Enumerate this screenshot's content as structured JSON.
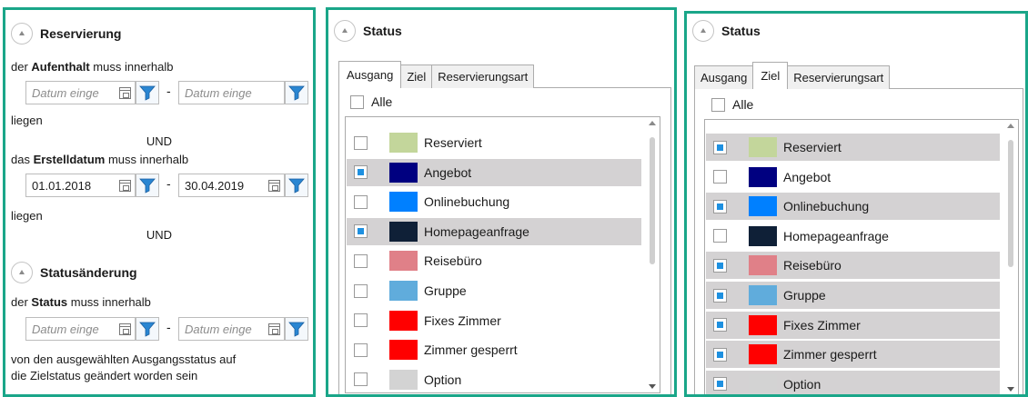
{
  "filter_panel": {
    "reservierung": {
      "title": "Reservierung",
      "aufenthalt_pre": "der ",
      "aufenthalt_bold": "Aufenthalt",
      "aufenthalt_post": " muss innerhalb",
      "date_from_placeholder": "Datum einge",
      "date_to_placeholder": "Datum einge",
      "dash": "-",
      "liegen_1": "liegen",
      "und_1": "UND",
      "erstell_pre": "das ",
      "erstell_bold": "Erstelldatum",
      "erstell_post": " muss innerhalb",
      "erstell_from": "01.01.2018",
      "erstell_to": "30.04.2019",
      "liegen_2": "liegen",
      "und_2": "UND"
    },
    "statusaenderung": {
      "title": "Statusänderung",
      "status_pre": "der ",
      "status_bold": "Status",
      "status_post": " muss innerhalb",
      "date_from_placeholder": "Datum einge",
      "date_to_placeholder": "Datum einge",
      "desc_line1": "von den ausgewählten Ausgangsstatus auf",
      "desc_line2": "die Zielstatus geändert worden sein"
    }
  },
  "status_panel_ausgang": {
    "title": "Status",
    "tabs": [
      {
        "label": "Ausgang",
        "active": true
      },
      {
        "label": "Ziel",
        "active": false
      },
      {
        "label": "Reservierungsart",
        "active": false
      }
    ],
    "all_label": "Alle",
    "all_checked": false,
    "items": [
      {
        "label": "Reserviert",
        "color": "#c3d69b",
        "checked": false
      },
      {
        "label": "Angebot",
        "color": "#000080",
        "checked": true
      },
      {
        "label": "Onlinebuchung",
        "color": "#0080ff",
        "checked": false
      },
      {
        "label": "Homepageanfrage",
        "color": "#0f2037",
        "checked": true
      },
      {
        "label": "Reisebüro",
        "color": "#e08088",
        "checked": false
      },
      {
        "label": "Gruppe",
        "color": "#60acdc",
        "checked": false
      },
      {
        "label": "Fixes Zimmer",
        "color": "#ff0000",
        "checked": false
      },
      {
        "label": "Zimmer gesperrt",
        "color": "#ff0000",
        "checked": false
      },
      {
        "label": "Option",
        "color": "#d3d3d3",
        "checked": false
      }
    ]
  },
  "status_panel_ziel": {
    "title": "Status",
    "tabs": [
      {
        "label": "Ausgang",
        "active": false
      },
      {
        "label": "Ziel",
        "active": true
      },
      {
        "label": "Reservierungsart",
        "active": false
      }
    ],
    "all_label": "Alle",
    "all_checked": false,
    "items": [
      {
        "label": "Reserviert",
        "color": "#c3d69b",
        "checked": true
      },
      {
        "label": "Angebot",
        "color": "#000080",
        "checked": false
      },
      {
        "label": "Onlinebuchung",
        "color": "#0080ff",
        "checked": true
      },
      {
        "label": "Homepageanfrage",
        "color": "#0f2037",
        "checked": false
      },
      {
        "label": "Reisebüro",
        "color": "#e08088",
        "checked": true
      },
      {
        "label": "Gruppe",
        "color": "#60acdc",
        "checked": true
      },
      {
        "label": "Fixes Zimmer",
        "color": "#ff0000",
        "checked": true
      },
      {
        "label": "Zimmer gesperrt",
        "color": "#ff0000",
        "checked": true
      },
      {
        "label": "Option",
        "color": "#d3d3d3",
        "checked": true
      }
    ]
  },
  "theme": {
    "frame_border": "#1aa689",
    "selected_row_bg": "#d4d2d3",
    "check_mark": "#1e90e0",
    "filter_icon": "#2a86d2"
  }
}
